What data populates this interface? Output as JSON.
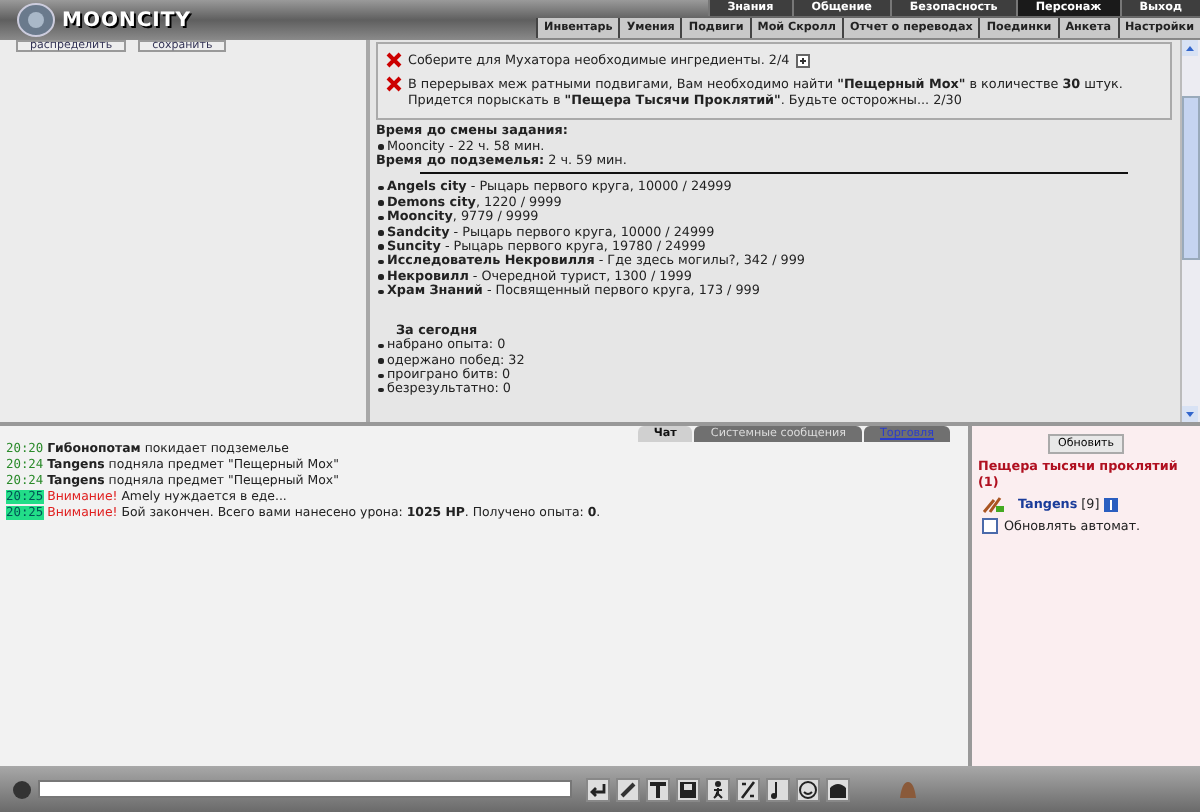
{
  "header": {
    "logo": "MOONCITY",
    "main_tabs": [
      {
        "label": "Знания",
        "selected": false
      },
      {
        "label": "Общение",
        "selected": false
      },
      {
        "label": "Безопасность",
        "selected": false
      },
      {
        "label": "Персонаж",
        "selected": true
      },
      {
        "label": "Выход",
        "selected": false
      }
    ],
    "sub_tabs": [
      "Инвентарь",
      "Умения",
      "Подвиги",
      "Мой Скролл",
      "Отчет о переводах",
      "Поединки",
      "Анкета",
      "Настройки"
    ]
  },
  "left_panel": {
    "buttons": [
      "распределить",
      "сохранить"
    ]
  },
  "quests": [
    {
      "text": "Соберите для Мухатора необходимые ингредиенты. 2/4",
      "expandable": true
    },
    {
      "text": "В перерывах меж ратными подвигами, Вам необходимо найти **\"Пещерный Мох\"** в количестве **30** штук. Придется порыскать в **\"Пещера Тысячи Проклятий\"**. Будьте осторожны... 2/30",
      "expandable": false
    }
  ],
  "timers": {
    "task_heading": "Время до смены задания:",
    "task_items": [
      "Mooncity - 22 ч. 58 мин."
    ],
    "dungeon_label": "Время до подземелья:",
    "dungeon_value": "2 ч. 59 мин."
  },
  "reputation": [
    {
      "name": "Angels city",
      "text": " - Рыцарь первого круга, 10000 / 24999"
    },
    {
      "name": "Demons city",
      "text": ", 1220 / 9999"
    },
    {
      "name": "Mooncity",
      "text": ", 9779 / 9999"
    },
    {
      "name": "Sandcity",
      "text": " - Рыцарь первого круга, 10000 / 24999"
    },
    {
      "name": "Suncity",
      "text": " - Рыцарь первого круга, 19780 / 24999"
    },
    {
      "name": "Исследователь Некровилля",
      "text": " - Где здесь могилы?, 342 / 999"
    },
    {
      "name": "Некровилл",
      "text": " - Очередной турист, 1300 / 1999"
    },
    {
      "name": "Храм Знаний",
      "text": " - Посвященный первого круга, 173 / 999"
    }
  ],
  "today": {
    "heading": "За сегодня",
    "items": [
      "набрано опыта: 0",
      "одержано побед: 32",
      "проиграно битв: 0",
      "безрезультатно: 0"
    ]
  },
  "chat_tabs": [
    {
      "label": "Чат",
      "selected": true
    },
    {
      "label": "Системные сообщения",
      "selected": false
    },
    {
      "label": "Торговля",
      "selected": false
    }
  ],
  "chat": [
    {
      "kind": "message",
      "time": "20:20",
      "highlighted": false,
      "sender": "Гибонопотам",
      "text": "покидает подземелье"
    },
    {
      "kind": "message",
      "time": "20:24",
      "highlighted": false,
      "sender": "Tangens",
      "text": "подняла предмет \"Пещерный Мох\""
    },
    {
      "kind": "message",
      "time": "20:24",
      "highlighted": false,
      "sender": "Tangens",
      "text": "подняла предмет \"Пещерный Мох\""
    },
    {
      "kind": "alert",
      "time": "20:25",
      "highlighted": true,
      "sender": "Внимание!",
      "text": "Amely нуждается в еде..."
    },
    {
      "kind": "alert",
      "time": "20:25",
      "highlighted": true,
      "sender": "Внимание!",
      "text": "Бой закончен. Всего вами нанесено урона: **1025 HP**. Получено опыта: **0**."
    }
  ],
  "room": {
    "refresh_button": "Обновить",
    "title": "Пещера тысячи проклятий (1)",
    "players": [
      {
        "name": "Tangens",
        "level": "[9]"
      }
    ],
    "auto_refresh": {
      "label": "Обновлять автомат.",
      "checked": false
    }
  }
}
